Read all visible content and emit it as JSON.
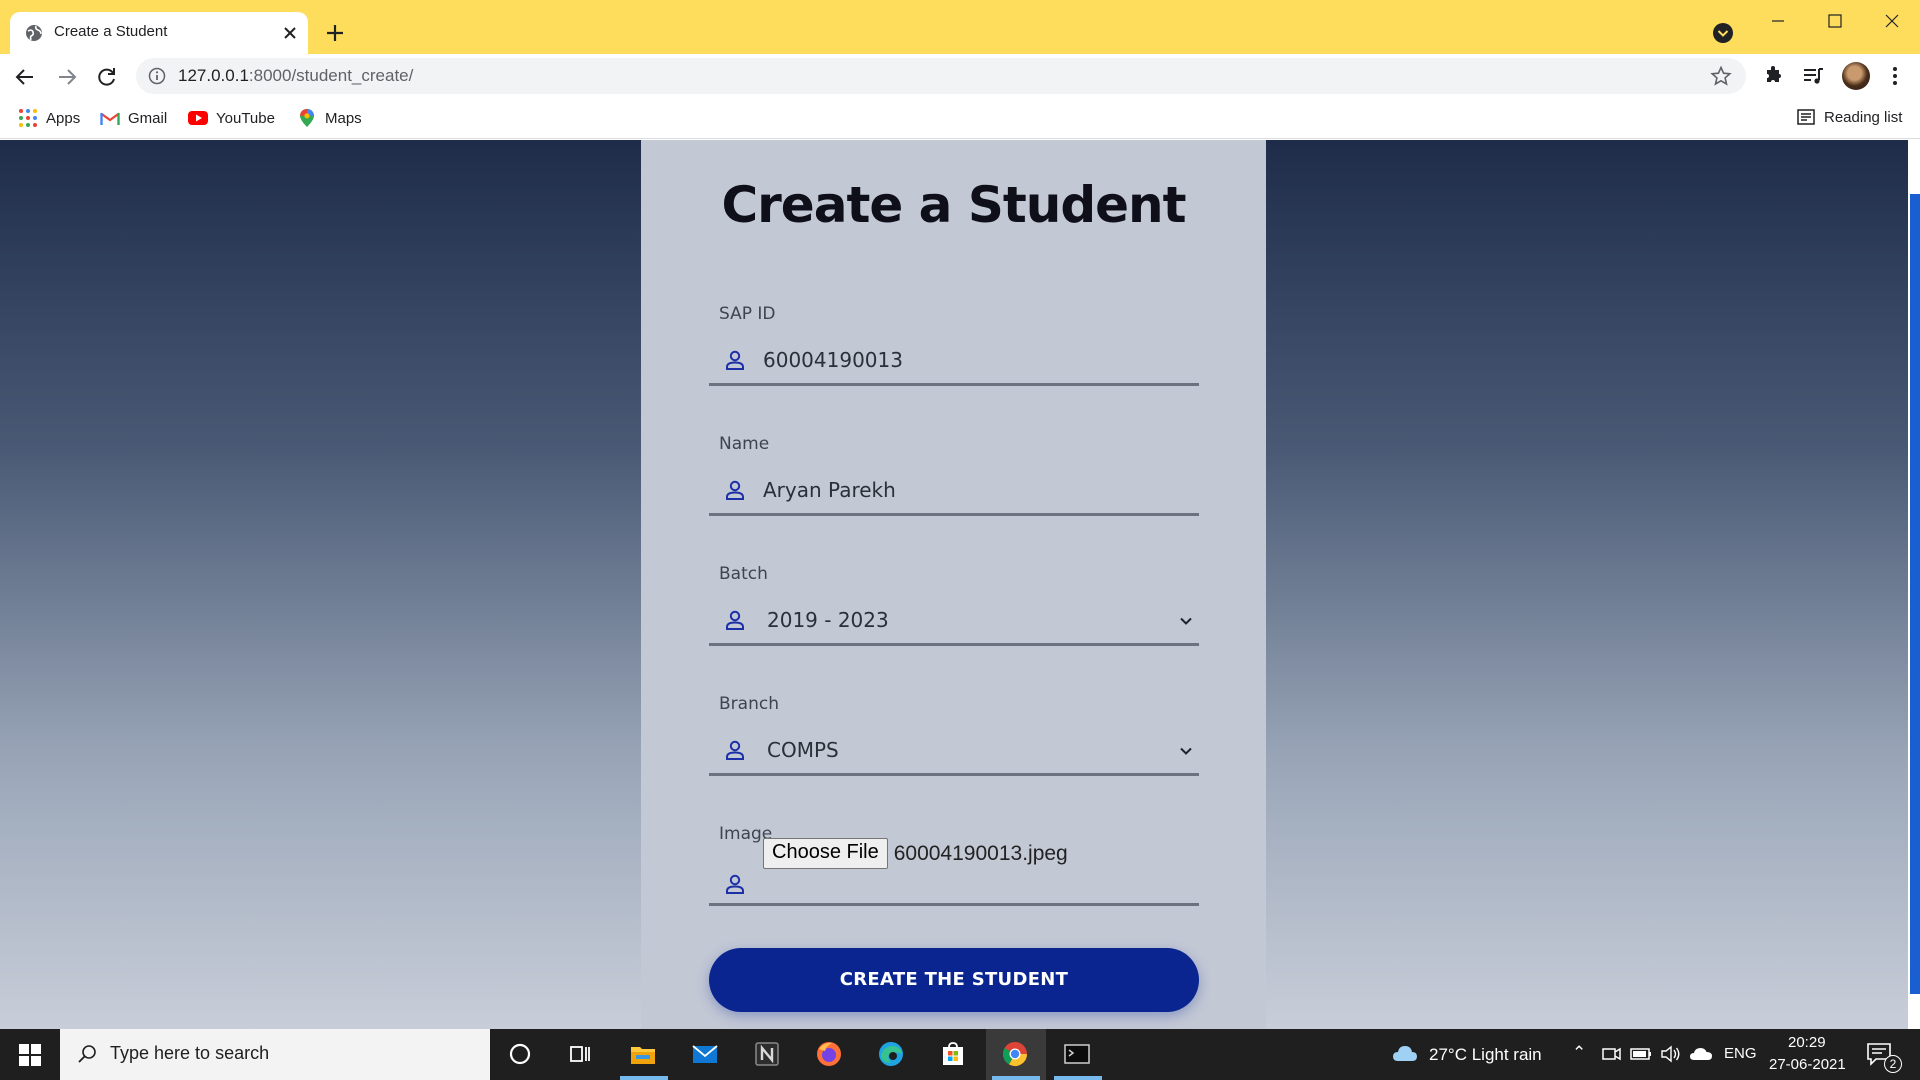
{
  "browser": {
    "tab_title": "Create a Student",
    "url_host": "127.0.0.1",
    "url_path": ":8000/student_create/",
    "bookmarks": [
      {
        "label": "Apps"
      },
      {
        "label": "Gmail"
      },
      {
        "label": "YouTube"
      },
      {
        "label": "Maps"
      }
    ],
    "reading_list": "Reading list",
    "accent": "#fedc5c"
  },
  "form": {
    "title": "Create a Student",
    "fields": [
      {
        "label": "SAP ID",
        "value": "60004190013"
      },
      {
        "label": "Name",
        "value": "Aryan Parekh"
      },
      {
        "label": "Batch",
        "value": "2019 - 2023"
      },
      {
        "label": "Branch",
        "value": "COMPS"
      },
      {
        "label": "Image",
        "button": "Choose File",
        "value": "60004190013.jpeg"
      }
    ],
    "submit": "CREATE THE STUDENT",
    "button_color": "#0a2590"
  },
  "taskbar": {
    "search_placeholder": "Type here to search",
    "weather": "27°C  Light rain",
    "language": "ENG",
    "time": "20:29",
    "date": "27-06-2021",
    "notifications": "2"
  }
}
